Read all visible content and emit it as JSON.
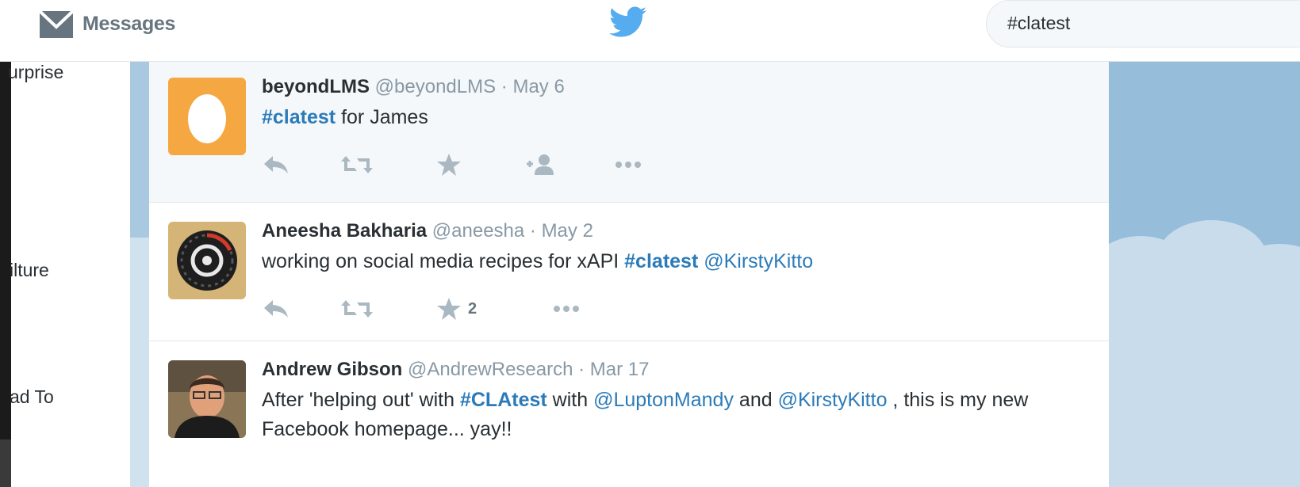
{
  "topbar": {
    "messages_label": "Messages",
    "search_value": "#clatest"
  },
  "sidebar": {
    "items": [
      {
        "label": "urprise"
      },
      {
        "label": "ilture"
      },
      {
        "label": "ad To"
      }
    ]
  },
  "tweets": [
    {
      "name": "beyondLMS",
      "handle": "@beyondLMS",
      "sep": " · ",
      "date": "May 6",
      "text_parts": [
        {
          "type": "hashtag",
          "text": "#clatest"
        },
        {
          "type": "text",
          "text": " for James"
        }
      ],
      "favorites": ""
    },
    {
      "name": "Aneesha Bakharia",
      "handle": "@aneesha",
      "sep": " · ",
      "date": "May 2",
      "text_parts": [
        {
          "type": "text",
          "text": "working on social media recipes for xAPI "
        },
        {
          "type": "hashtag",
          "text": "#clatest"
        },
        {
          "type": "text",
          "text": " "
        },
        {
          "type": "mention",
          "text": "@KirstyKitto"
        }
      ],
      "favorites": "2"
    },
    {
      "name": "Andrew Gibson",
      "handle": "@AndrewResearch",
      "sep": " · ",
      "date": "Mar 17",
      "text_parts": [
        {
          "type": "text",
          "text": "After 'helping out' with "
        },
        {
          "type": "hashtag",
          "text": "#CLAtest"
        },
        {
          "type": "text",
          "text": " with "
        },
        {
          "type": "mention",
          "text": "@LuptonMandy"
        },
        {
          "type": "text",
          "text": " and "
        },
        {
          "type": "mention",
          "text": "@KirstyKitto"
        },
        {
          "type": "text",
          "text": " , this is my new Facebook homepage... yay!!"
        }
      ],
      "favorites": ""
    }
  ],
  "icons": {
    "messages": "envelope-icon",
    "logo": "twitter-bird-icon",
    "reply": "reply-icon",
    "retweet": "retweet-icon",
    "favorite": "star-icon",
    "follow": "follow-icon",
    "more": "more-icon"
  },
  "colors": {
    "accent": "#55acee",
    "link": "#2b7bb9",
    "avatar_egg_bg": "#f5a742",
    "sky": "#96bdda"
  }
}
